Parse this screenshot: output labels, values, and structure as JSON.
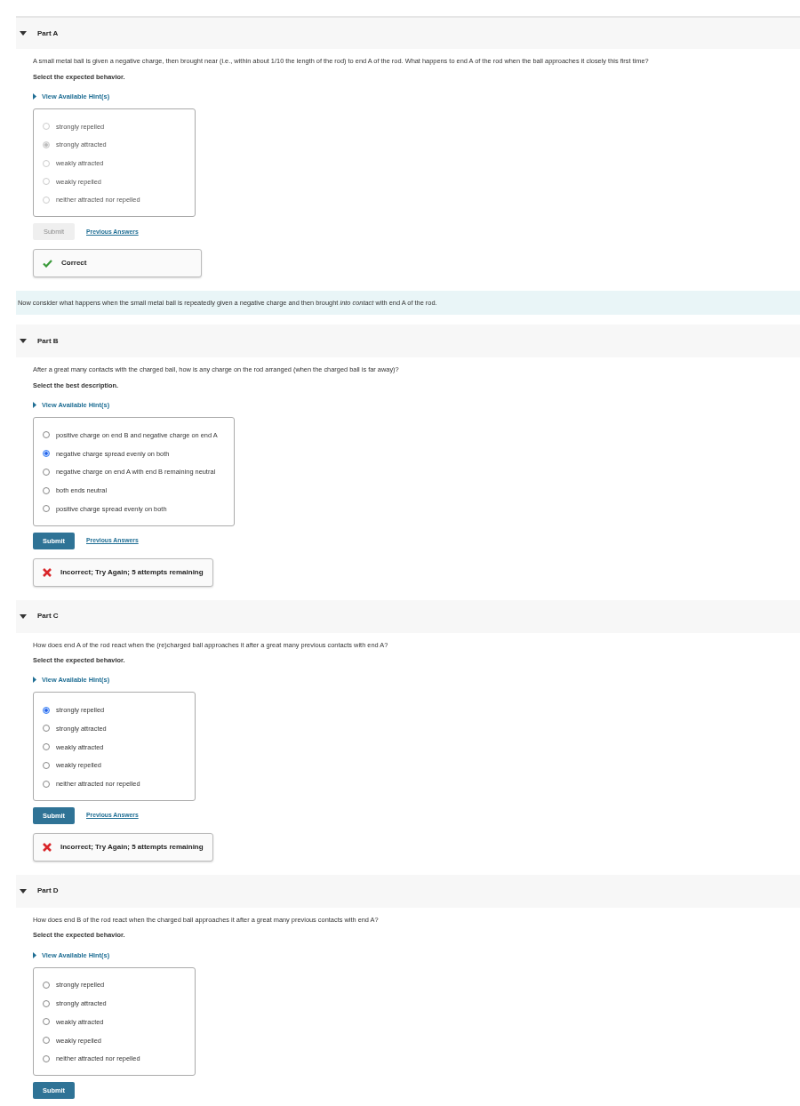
{
  "sections": [
    {
      "kind": "part",
      "title": "Part A",
      "question": "A small metal ball is given a negative charge, then brought near (i.e., within about 1/10 the length of the rod) to end A of the rod. What happens to end A of the rod when the ball approaches it closely this first time?",
      "instruction": "Select the expected behavior.",
      "hint_link": "View Available Hint(s)",
      "options_disabled": true,
      "options": [
        {
          "label": "strongly repelled",
          "selected": false
        },
        {
          "label": "strongly attracted",
          "selected": true
        },
        {
          "label": "weakly attracted",
          "selected": false
        },
        {
          "label": "weakly repelled",
          "selected": false
        },
        {
          "label": "neither attracted nor repelled",
          "selected": false
        }
      ],
      "submit": {
        "label": "Submit",
        "disabled": true
      },
      "previous_answers": "Previous Answers",
      "feedback": {
        "kind": "correct",
        "text": "Correct"
      }
    },
    {
      "kind": "note",
      "text": "Now consider what happens when the small metal ball is repeatedly given a negative charge and then brought *into contact* with end A of the rod."
    },
    {
      "kind": "part",
      "title": "Part B",
      "question": "After a great many contacts with the charged ball, how is any charge on the rod arranged (when the charged ball is far away)?",
      "instruction": "Select the best description.",
      "hint_link": "View Available Hint(s)",
      "options_disabled": false,
      "options": [
        {
          "label": "positive charge on end B and negative charge on end A",
          "selected": false
        },
        {
          "label": "negative charge spread evenly on both",
          "selected": true
        },
        {
          "label": "negative charge on end A with end B remaining neutral",
          "selected": false
        },
        {
          "label": "both ends neutral",
          "selected": false
        },
        {
          "label": "positive charge spread evenly on both",
          "selected": false
        }
      ],
      "submit": {
        "label": "Submit",
        "disabled": false
      },
      "previous_answers": "Previous Answers",
      "feedback": {
        "kind": "incorrect",
        "text": "Incorrect; Try Again; 5 attempts remaining"
      }
    },
    {
      "kind": "part",
      "title": "Part C",
      "question": "How does end A of the rod react when the (re)charged ball approaches it after a great many previous contacts with end A?",
      "instruction": "Select the expected behavior.",
      "hint_link": "View Available Hint(s)",
      "options_disabled": false,
      "options": [
        {
          "label": "strongly repelled",
          "selected": true
        },
        {
          "label": "strongly attracted",
          "selected": false
        },
        {
          "label": "weakly attracted",
          "selected": false
        },
        {
          "label": "weakly repelled",
          "selected": false
        },
        {
          "label": "neither attracted nor repelled",
          "selected": false
        }
      ],
      "submit": {
        "label": "Submit",
        "disabled": false
      },
      "previous_answers": "Previous Answers",
      "feedback": {
        "kind": "incorrect",
        "text": "Incorrect; Try Again; 5 attempts remaining"
      }
    },
    {
      "kind": "part",
      "title": "Part D",
      "question": "How does end B of the rod react when the charged ball approaches it after a great many previous contacts with end A?",
      "instruction": "Select the expected behavior.",
      "hint_link": "View Available Hint(s)",
      "options_disabled": false,
      "options": [
        {
          "label": "strongly repelled",
          "selected": false
        },
        {
          "label": "strongly attracted",
          "selected": false
        },
        {
          "label": "weakly attracted",
          "selected": false
        },
        {
          "label": "weakly repelled",
          "selected": false
        },
        {
          "label": "neither attracted nor repelled",
          "selected": false
        }
      ],
      "submit": {
        "label": "Submit",
        "disabled": false
      }
    }
  ]
}
